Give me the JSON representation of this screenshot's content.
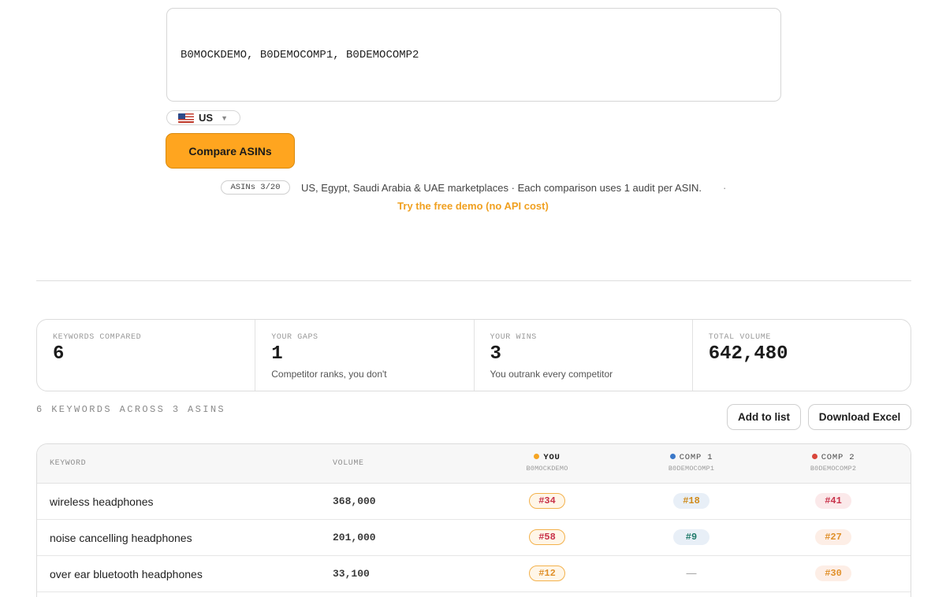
{
  "asin_input": {
    "value": "B0MOCKDEMO, B0DEMOCOMP1, B0DEMOCOMP2"
  },
  "marketplace": {
    "selected": "US",
    "flag_icon": "us-flag-icon"
  },
  "compare_button": {
    "label": "Compare ASINs"
  },
  "quota": {
    "label": "ASINs 3/20"
  },
  "info_text": "US, Egypt, Saudi Arabia & UAE marketplaces · Each comparison uses 1 audit per ASIN.",
  "info_separator": "·",
  "demo_link": "Try the free demo (no API cost)",
  "stats": [
    {
      "label": "KEYWORDS COMPARED",
      "value": "6",
      "sub": ""
    },
    {
      "label": "YOUR GAPS",
      "value": "1",
      "sub": "Competitor ranks, you don't"
    },
    {
      "label": "YOUR WINS",
      "value": "3",
      "sub": "You outrank every competitor"
    },
    {
      "label": "TOTAL VOLUME",
      "value": "642,480",
      "sub": ""
    }
  ],
  "table_caption": "6 KEYWORDS ACROSS 3 ASINS",
  "actions": {
    "add_to_list": "Add to list",
    "download_excel": "Download Excel"
  },
  "table": {
    "headers": {
      "keyword": "KEYWORD",
      "volume": "VOLUME",
      "you": {
        "name": "YOU",
        "asin": "B0MOCKDEMO",
        "color": "#f5a524"
      },
      "comp1": {
        "name": "COMP 1",
        "asin": "B0DEMOCOMP1",
        "color": "#3a78c9"
      },
      "comp2": {
        "name": "COMP 2",
        "asin": "B0DEMOCOMP2",
        "color": "#d9463b"
      }
    },
    "rows": [
      {
        "keyword": "wireless headphones",
        "volume": "368,000",
        "you": {
          "rank": "#34",
          "text": "#c8324a"
        },
        "comp1": {
          "rank": "#18",
          "text": "#d08a1a",
          "bg": "#e8eff7"
        },
        "comp2": {
          "rank": "#41",
          "text": "#c8324a",
          "bg": "#fbe9ea"
        }
      },
      {
        "keyword": "noise cancelling headphones",
        "volume": "201,000",
        "you": {
          "rank": "#58",
          "text": "#c8324a"
        },
        "comp1": {
          "rank": "#9",
          "text": "#1f7a6a",
          "bg": "#e8eff7"
        },
        "comp2": {
          "rank": "#27",
          "text": "#e0902a",
          "bg": "#fdeee6"
        }
      },
      {
        "keyword": "over ear bluetooth headphones",
        "volume": "33,100",
        "you": {
          "rank": "#12",
          "text": "#e0902a"
        },
        "comp1": {
          "rank": "—",
          "text": "#999999",
          "bg": ""
        },
        "comp2": {
          "rank": "#30",
          "text": "#e0902a",
          "bg": "#fdeee6"
        }
      }
    ]
  }
}
